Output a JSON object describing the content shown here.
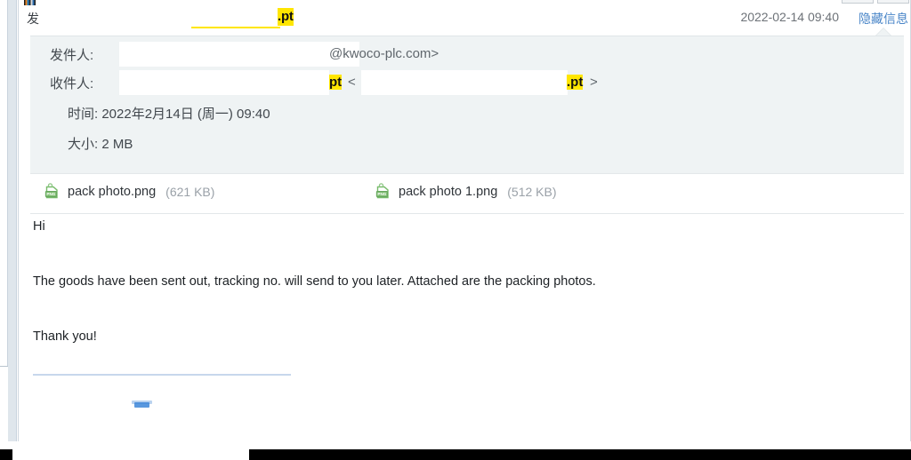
{
  "window": {
    "app_icon": "app-icon",
    "toolbar_buttons": [
      "toolbar-button-a",
      "toolbar-button-b"
    ]
  },
  "header": {
    "subject_label": "发",
    "subject_tail": ".pt",
    "date": "2022-02-14 09:40",
    "toggle_info_label": "隐藏信息"
  },
  "details": {
    "sender": {
      "label": "发件人:",
      "domain": "@kwoco-plc.com>"
    },
    "recipient": {
      "label": "收件人:",
      "highlight_1": "pt",
      "bracket_open": "<",
      "highlight_2": ".pt",
      "bracket_close": ">"
    },
    "time": {
      "label": "时间:",
      "value": "2022年2月14日 (周一) 09:40",
      "full": "时间: 2022年2月14日 (周一) 09:40"
    },
    "size": {
      "label": "大小:",
      "value": "2 MB",
      "full": "大小: 2 MB"
    }
  },
  "attachments": [
    {
      "icon": "png-file-icon",
      "icon_label": "PNG",
      "name": "pack photo.png",
      "size": "(621 KB)"
    },
    {
      "icon": "png-file-icon",
      "icon_label": "PNG",
      "name": "pack photo 1.png",
      "size": "(512 KB)"
    }
  ],
  "body": {
    "greeting": "Hi",
    "paragraph": "The goods have been sent out, tracking no. will send to you later. Attached are the packing photos.",
    "closing": "Thank you!"
  },
  "colors": {
    "highlight": "#ffe600",
    "link": "#4a86c8",
    "panel_bg": "#eff3f4",
    "png_icon": "#77bb6a",
    "signature_rule": "#c7d7ec"
  }
}
